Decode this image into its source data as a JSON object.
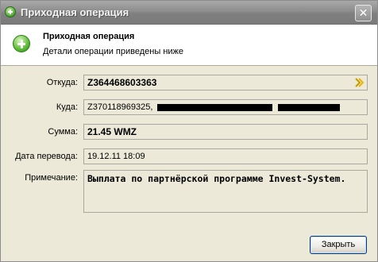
{
  "window": {
    "title": "Приходная операция"
  },
  "header": {
    "title": "Приходная операция",
    "subtitle": "Детали операции приведены ниже"
  },
  "fields": {
    "from": {
      "label": "Откуда:",
      "value": "Z364468603363"
    },
    "to": {
      "label": "Куда:",
      "value": "Z370118969325,"
    },
    "sum": {
      "label": "Сумма:",
      "value": "21.45 WMZ"
    },
    "date": {
      "label": "Дата перевода:",
      "value": "19.12.11 18:09"
    },
    "note": {
      "label": "Примечание:",
      "value": "Выплата по партнёрской программе Invest-System."
    }
  },
  "buttons": {
    "close": "Закрыть",
    "titlebar_close": "✕"
  },
  "icons": {
    "title": "plus-circle-icon",
    "header": "plus-circle-icon",
    "from_go": "double-chevron-right-icon"
  }
}
